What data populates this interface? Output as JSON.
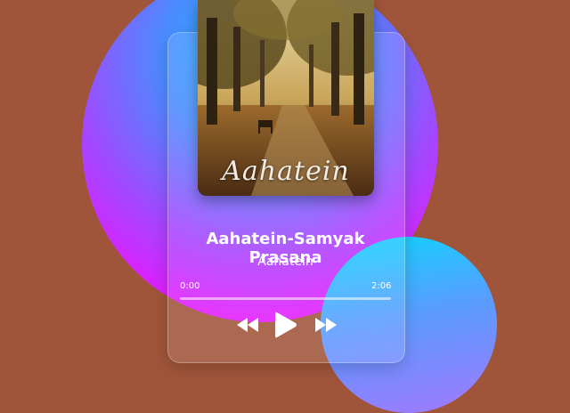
{
  "album": {
    "cover_text": "Aahatein"
  },
  "track": {
    "title": "Aahatein-Samyak Prasana",
    "artist": "Aahatein"
  },
  "player": {
    "current_time": "0:00",
    "total_time": "2:06",
    "progress": 0
  },
  "controls": {
    "prev_icon": "rewind-icon",
    "play_icon": "play-icon",
    "next_icon": "fast-forward-icon"
  },
  "colors": {
    "background": "#a0553a",
    "accent": "#e21cff",
    "secondary": "#21b8ff"
  }
}
